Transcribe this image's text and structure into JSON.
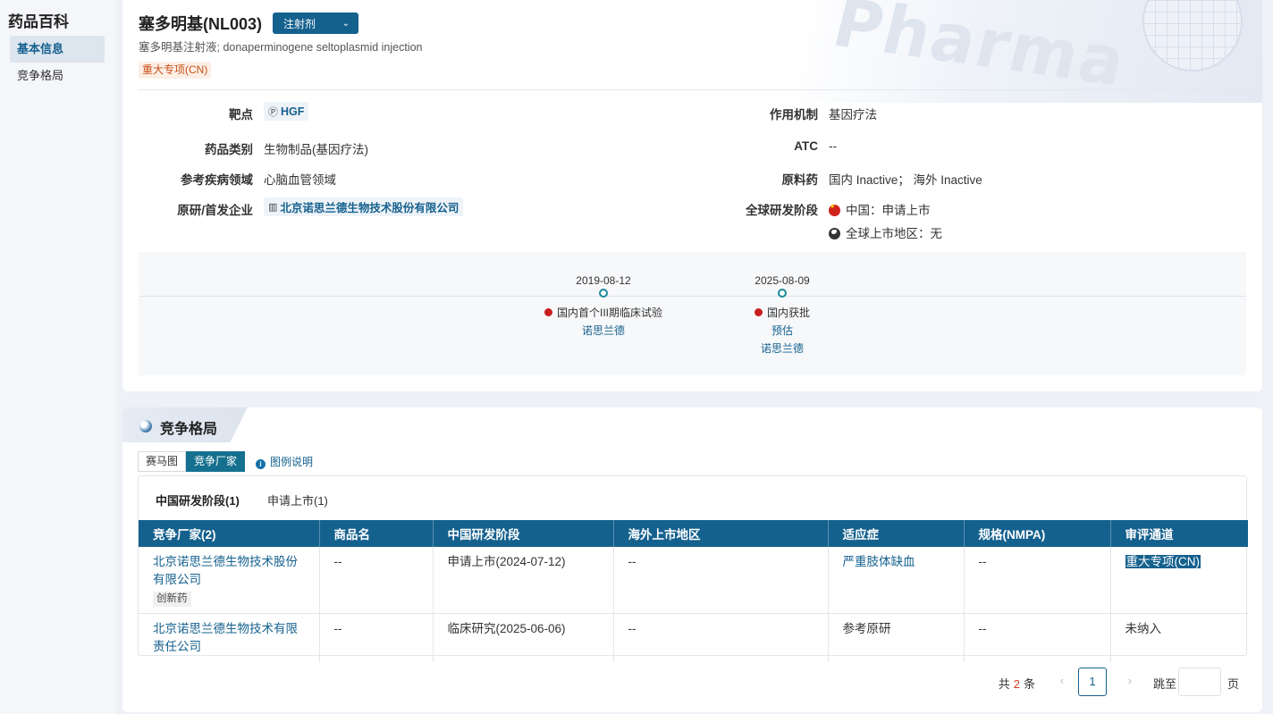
{
  "sidebar": {
    "title": "药品百科",
    "items": [
      {
        "label": "基本信息",
        "active": true
      },
      {
        "label": "竞争格局",
        "active": false
      }
    ]
  },
  "header": {
    "drug_name": "塞多明基(NL003)",
    "dosage_form": "注射剂",
    "subtitle": "塞多明基注射液; donaperminogene seltoplasmid injection",
    "badge": "重大专项(CN)",
    "hero_text": "Pharma"
  },
  "info": {
    "target_label": "靶点",
    "target_value": "HGF",
    "mechanism_label": "作用机制",
    "mechanism_value": "基因疗法",
    "category_label": "药品类别",
    "category_value": "生物制品(基因疗法)",
    "atc_label": "ATC",
    "atc_value": "--",
    "disease_label": "参考疾病领域",
    "disease_value": "心脑血管领域",
    "api_label": "原料药",
    "api_value": "国内 Inactive； 海外 Inactive",
    "originator_label": "原研/首发企业",
    "originator_value": "北京诺思兰德生物技术股份有限公司",
    "global_stage_label": "全球研发阶段",
    "china_stage": "中国：申请上市",
    "global_market": "全球上市地区：无"
  },
  "timeline": [
    {
      "date": "2019-08-12",
      "event": "国内首个III期临床试验",
      "estimate": "",
      "company": "诺思兰德"
    },
    {
      "date": "2025-08-09",
      "event": "国内获批",
      "estimate": "预估",
      "company": "诺思兰德"
    }
  ],
  "competition": {
    "section_title": "竞争格局",
    "view_tabs": [
      "赛马图",
      "竞争厂家"
    ],
    "legend_link": "图例说明",
    "stage_tabs": [
      "中国研发阶段(1)",
      "申请上市(1)"
    ],
    "columns": [
      "竞争厂家(2)",
      "商品名",
      "中国研发阶段",
      "海外上市地区",
      "适应症",
      "规格(NMPA)",
      "审评通道"
    ],
    "rows": [
      {
        "company": "北京诺思兰德生物技术股份有限公司",
        "tag": "创新药",
        "brand": "--",
        "stage": "申请上市(2024-07-12)",
        "overseas": "--",
        "indication": "严重肢体缺血",
        "spec": "--",
        "channel": "重大专项(CN)"
      },
      {
        "company": "北京诺思兰德生物技术有限责任公司",
        "tag": "",
        "brand": "--",
        "stage": "临床研究(2025-06-06)",
        "overseas": "--",
        "indication": "参考原研",
        "spec": "--",
        "channel": "未纳入"
      }
    ]
  },
  "pagination": {
    "total_prefix": "共",
    "total_count": "2",
    "total_suffix": "条",
    "current_page": "1",
    "jump_label": "跳至",
    "page_unit": "页"
  }
}
